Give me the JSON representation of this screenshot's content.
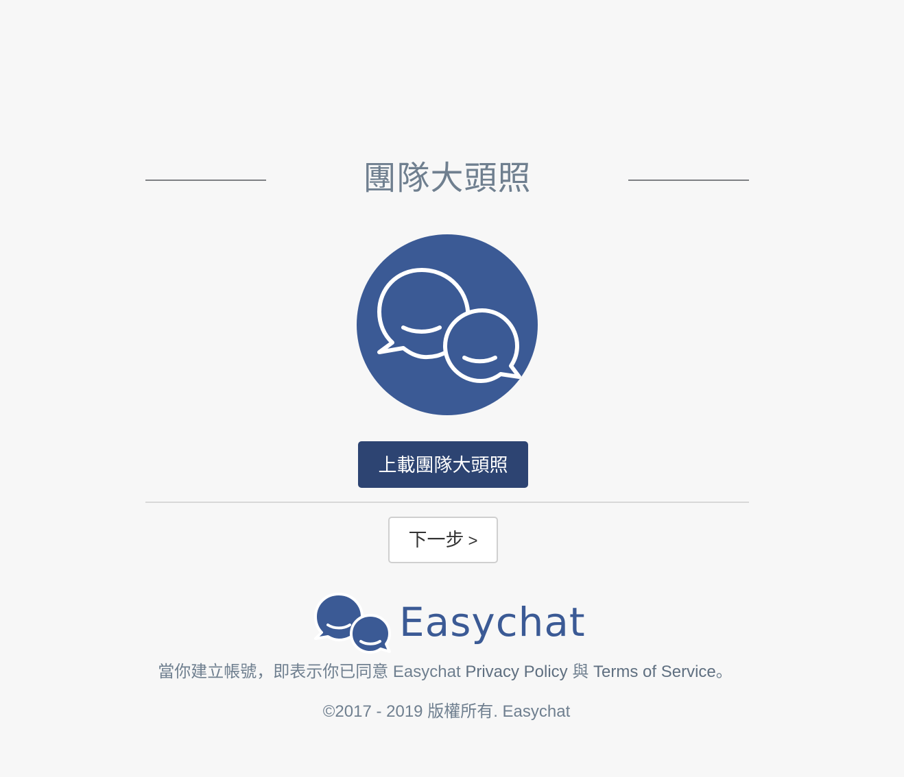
{
  "header": {
    "title": "團隊大頭照"
  },
  "avatar": {
    "icon": "chat-bubbles-icon",
    "color": "#3b5a95"
  },
  "actions": {
    "upload_label": "上載團隊大頭照",
    "next_label": "下一步",
    "next_chevron": ">"
  },
  "brand": {
    "name": "Easychat",
    "icon": "easychat-logo-icon",
    "color": "#3b5a95"
  },
  "legal": {
    "prefix": "當你建立帳號，即表示你已同意 Easychat ",
    "privacy_link": "Privacy Policy",
    "middle": " 與 ",
    "terms_link": "Terms of Service",
    "suffix": "。"
  },
  "footer": {
    "copyright": "©2017 - 2019 版權所有. Easychat"
  },
  "colors": {
    "accent": "#3b5a95",
    "button_dark": "#2d4472",
    "text_muted": "#6f7f8f"
  }
}
